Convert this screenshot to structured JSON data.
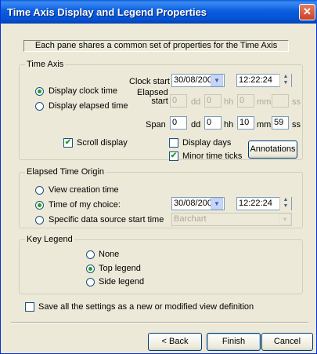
{
  "window": {
    "title": "Time Axis Display and Legend Properties",
    "close_glyph": "✕"
  },
  "info_text": "Each pane shares a common set of properties for the Time Axis",
  "time_axis": {
    "group_label": "Time Axis",
    "display_clock_time": "Display clock time",
    "display_elapsed_time": "Display elapsed time",
    "clock_start_label": "Clock start",
    "clock_start_date": "30/08/2005",
    "clock_start_time": "12:22:24",
    "elapsed_start_label_1": "Elapsed",
    "elapsed_start_label_2": "start",
    "elapsed_dd": "0",
    "elapsed_hh": "0",
    "elapsed_mm": "0",
    "elapsed_ss": "",
    "unit_dd": "dd",
    "unit_hh": "hh",
    "unit_mm": "mm",
    "unit_ss": "ss",
    "span_label": "Span",
    "span_dd": "0",
    "span_hh": "0",
    "span_mm": "10",
    "span_ss": "59",
    "scroll_display": "Scroll display",
    "display_days": "Display days",
    "minor_time_ticks": "Minor time ticks",
    "annotations_button": "Annotations"
  },
  "elapsed_origin": {
    "group_label": "Elapsed Time Origin",
    "view_creation_time": "View creation time",
    "time_of_my_choice": "Time of my choice:",
    "specific_source": "Specific data source start time",
    "choice_date": "30/08/2005",
    "choice_time": "12:22:24",
    "source_value": "Barchart"
  },
  "key_legend": {
    "group_label": "Key Legend",
    "none": "None",
    "top_legend": "Top legend",
    "side_legend": "Side legend"
  },
  "save_settings": "Save all the settings as a new or modified view definition",
  "buttons": {
    "back": "< Back",
    "finish": "Finish",
    "cancel": "Cancel"
  }
}
